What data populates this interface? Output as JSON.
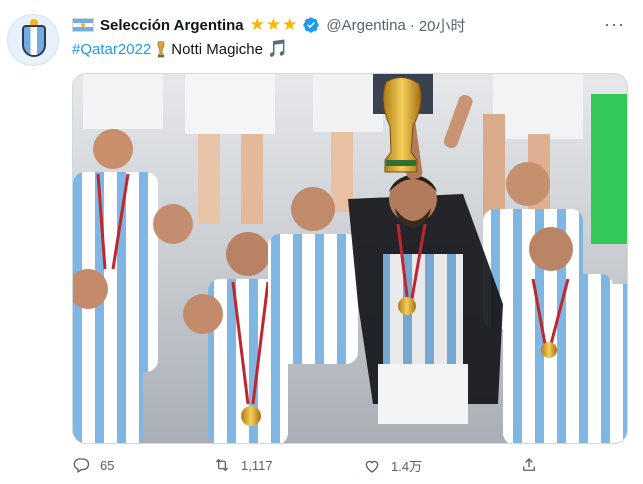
{
  "tweet": {
    "author": {
      "name": "Selección Argentina",
      "stars": "★★★",
      "handle": "@Argentina",
      "separator": "·",
      "time": "20小时"
    },
    "text": {
      "hashtag": "#Qatar2022",
      "body": "Notti Magiche",
      "music_note": "🎵"
    },
    "media": {
      "kind": "photo"
    },
    "actions": {
      "replies": "65",
      "retweets": "1,117",
      "likes": "1.4万"
    },
    "more_glyph": "···"
  },
  "colors": {
    "accent": "#1d9bf0",
    "verified": "#1d9bf0",
    "muted": "#536471",
    "stars": "#f5b800",
    "argentina_blue": "#74acdf"
  },
  "icons": [
    "flag-argentina-icon",
    "star-icon",
    "verified-badge-icon",
    "more-icon",
    "trophy-icon",
    "music-note-icon",
    "reply-icon",
    "retweet-icon",
    "like-icon",
    "share-icon"
  ]
}
